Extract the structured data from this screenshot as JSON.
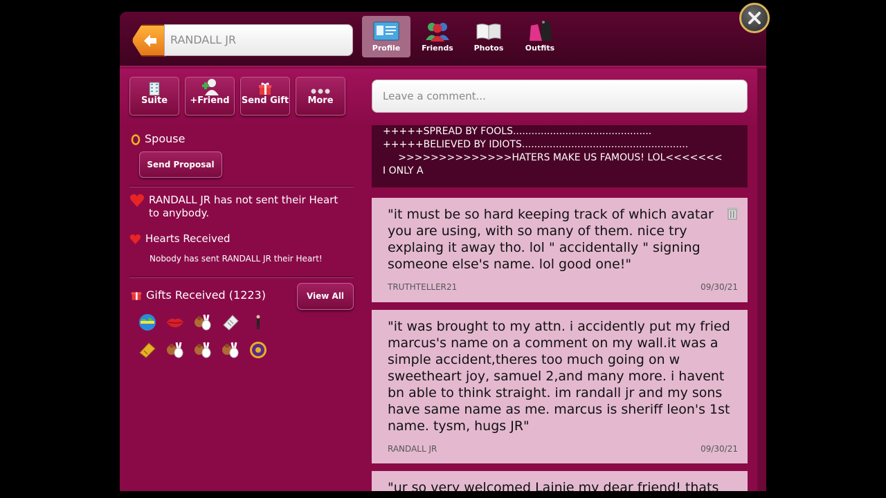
{
  "header": {
    "search_value": "RANDALL JR",
    "tabs": [
      {
        "label": "Profile",
        "icon": "profile-card-icon",
        "active": true
      },
      {
        "label": "Friends",
        "icon": "friends-icon",
        "active": false
      },
      {
        "label": "Photos",
        "icon": "photo-album-icon",
        "active": false
      },
      {
        "label": "Outfits",
        "icon": "outfit-icon",
        "active": false
      }
    ]
  },
  "actions": [
    {
      "label": "Suite",
      "icon": "building-icon"
    },
    {
      "label": "+Friend",
      "icon": "add-friend-icon"
    },
    {
      "label": "Send Gift",
      "icon": "gift-icon"
    },
    {
      "label": "More",
      "icon": "more-dots-icon"
    }
  ],
  "comment": {
    "placeholder": "Leave a comment..."
  },
  "left": {
    "spouse_label": "Spouse",
    "proposal_button": "Send Proposal",
    "heart_sent_text": "RANDALL JR has not sent their Heart to anybody.",
    "hearts_received_label": "Hearts Received",
    "hearts_received_note": "Nobody has sent RANDALL JR their Heart!",
    "gifts_label": "Gifts Received (1223)",
    "view_all_button": "View All",
    "gifts": [
      "globe-gift-icon",
      "lips-gift-icon",
      "bunny-gift-icon",
      "ticket-gift-icon",
      "figure-gift-icon",
      "golden-ticket-gift-icon",
      "bunny-gift-icon",
      "bunny-gift-icon",
      "bunny-gift-icon",
      "emblem-gift-icon"
    ]
  },
  "wall": {
    "top_lines": [
      "+++++SPREAD BY FOOLS.............................................",
      "+++++BELIEVED BY IDIOTS......................................................",
      "     >>>>>>>>>>>>>>HATERS MAKE US FAMOUS! LOL<<<<<<<",
      "I ONLY A"
    ],
    "posts": [
      {
        "text": "\"it must be so hard keeping track of which avatar you are using, with so many of them. nice try explaing it away tho. lol \" accidentally \" signing someone else's name. lol good one!\"",
        "author": "TRUTHTELLER21",
        "date": "09/30/21"
      },
      {
        "text": "\"it was brought to my attn. i accidently put my fried marcus's name on a comment on my wall.it was a simple accident,theres too much going on w sweetheart joy, samuel 2,and many more. i havent bn able to think straight. im randall jr and my sons have same name as me. marcus is sheriff leon's 1st name. tysm, hugs JR\"",
        "author": "RANDALL JR",
        "date": "09/30/21"
      },
      {
        "text": "\"ur so very welcomed Lainie my dear friend! thats",
        "author": "",
        "date": ""
      }
    ]
  }
}
